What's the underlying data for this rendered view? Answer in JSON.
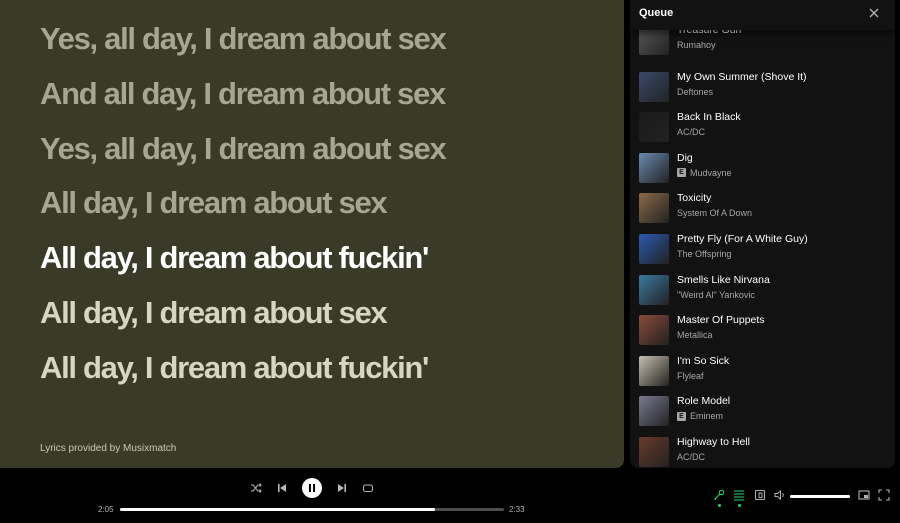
{
  "lyrics": {
    "lines": [
      "Yes, all day, I dream about sex",
      "And all day, I dream about sex",
      "Yes, all day, I dream about sex",
      "All day, I dream about sex",
      "All day, I dream about fuckin'",
      "All day, I dream about sex",
      "All day, I dream about fuckin'"
    ],
    "active_line_index": 4,
    "credit": "Lyrics provided by Musixmatch",
    "background_color": "#393a27"
  },
  "queue": {
    "title": "Queue",
    "close_icon": "close-icon",
    "items": [
      {
        "song": "Treasure Gun",
        "artist": "Rumahoy",
        "explicit": false,
        "art": "#5a5a5a"
      },
      {
        "song": "My Own Summer (Shove It)",
        "artist": "Deftones",
        "explicit": false,
        "art": "#3a4a6a"
      },
      {
        "song": "Back In Black",
        "artist": "AC/DC",
        "explicit": false,
        "art": "#1a1a1a"
      },
      {
        "song": "Dig",
        "artist": "Mudvayne",
        "explicit": true,
        "art": "#6a8ab0"
      },
      {
        "song": "Toxicity",
        "artist": "System Of A Down",
        "explicit": false,
        "art": "#8a6a4a"
      },
      {
        "song": "Pretty Fly (For A White Guy)",
        "artist": "The Offspring",
        "explicit": false,
        "art": "#2a5ab0"
      },
      {
        "song": "Smells Like Nirvana",
        "artist": "\"Weird Al\" Yankovic",
        "explicit": false,
        "art": "#3a7aa0"
      },
      {
        "song": "Master Of Puppets",
        "artist": "Metallica",
        "explicit": false,
        "art": "#8a4a3a"
      },
      {
        "song": "I'm So Sick",
        "artist": "Flyleaf",
        "explicit": false,
        "art": "#c8c0b0"
      },
      {
        "song": "Role Model",
        "artist": "Eminem",
        "explicit": true,
        "art": "#7a7a90"
      },
      {
        "song": "Highway to Hell",
        "artist": "AC/DC",
        "explicit": false,
        "art": "#6a3a2a"
      }
    ],
    "explicit_label": "E"
  },
  "player": {
    "elapsed": "2:05",
    "duration": "2:33",
    "progress_fraction": 0.82,
    "volume_fraction": 1.0,
    "accent_color": "#1ed760",
    "controls": [
      "shuffle-icon",
      "previous-icon",
      "pause-icon",
      "next-icon",
      "repeat-icon"
    ],
    "right_controls": [
      "lyrics-icon",
      "queue-icon",
      "connect-device-icon",
      "volume-icon",
      "miniplayer-icon",
      "fullscreen-icon"
    ]
  }
}
